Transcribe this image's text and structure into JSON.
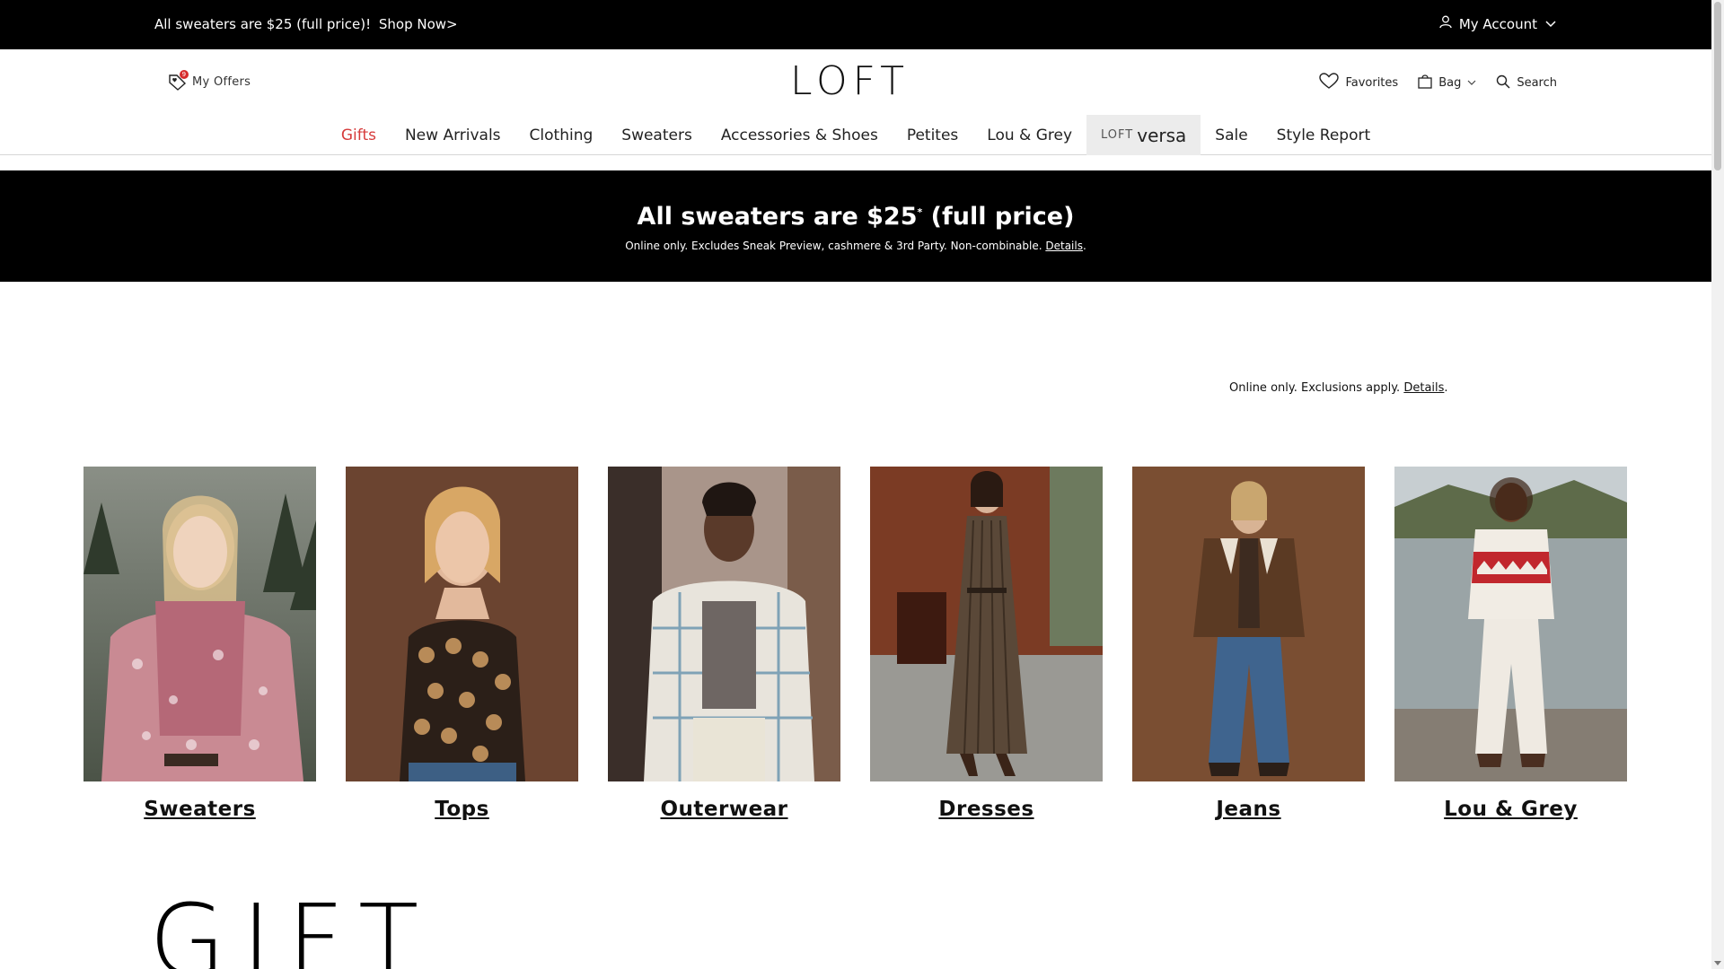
{
  "topbar": {
    "promo_text": "All sweaters are $25 (full price)!",
    "promo_link": "Shop Now>",
    "account_label": "My Account"
  },
  "header": {
    "offers_label": "My Offers",
    "offers_badge": "9",
    "logo": "LOFT",
    "favorites_label": "Favorites",
    "bag_label": "Bag",
    "search_label": "Search"
  },
  "nav": {
    "items": [
      {
        "label": "Gifts"
      },
      {
        "label": "New Arrivals"
      },
      {
        "label": "Clothing"
      },
      {
        "label": "Sweaters"
      },
      {
        "label": "Accessories & Shoes"
      },
      {
        "label": "Petites"
      },
      {
        "label": "Lou & Grey"
      },
      {
        "label_small": "LOFT",
        "label_big": "versa"
      },
      {
        "label": "Sale"
      },
      {
        "label": "Style Report"
      }
    ]
  },
  "banner": {
    "headline_a": "All sweaters are $25",
    "headline_sup": "*",
    "headline_b": " (full price)",
    "subtext": "Online only. Excludes Sneak Preview, cashmere & 3rd Party. Non-combinable.",
    "details_link": "Details"
  },
  "exclusions": {
    "text": "Online only. Exclusions apply.",
    "details_link": "Details"
  },
  "categories": [
    {
      "label": "Sweaters"
    },
    {
      "label": "Tops"
    },
    {
      "label": "Outerwear"
    },
    {
      "label": "Dresses"
    },
    {
      "label": "Jeans"
    },
    {
      "label": "Lou & Grey"
    }
  ],
  "gift_heading": "GIFT",
  "colors": {
    "accent_red": "#d63b3b",
    "black": "#000000"
  }
}
